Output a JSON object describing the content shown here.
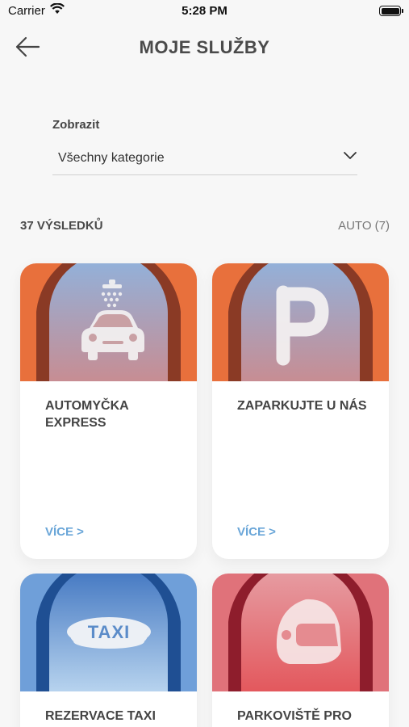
{
  "status_bar": {
    "carrier": "Carrier",
    "time": "5:28 PM"
  },
  "header": {
    "title": "MOJE SLUŽBY",
    "back_icon": "arrow-left-icon"
  },
  "filter": {
    "label": "Zobrazit",
    "selected": "Všechny kategorie"
  },
  "results": {
    "count_label": "37 VÝSLEDKŮ",
    "filter_chip": "AUTO (7)"
  },
  "cards": [
    {
      "title": "AUTOMYČKA EXPRESS",
      "link": "VÍCE >",
      "icon": "car-wash-icon",
      "colors": {
        "arch": "#e8703c",
        "sky_top": "#8fb3de",
        "sky_bottom": "#c78d93"
      }
    },
    {
      "title": "ZAPARKUJTE U NÁS",
      "link": "VÍCE >",
      "icon": "parking-icon",
      "colors": {
        "arch": "#e8703c",
        "sky_top": "#8fb3de",
        "sky_bottom": "#c78d93"
      }
    },
    {
      "title": "REZERVACE TAXI",
      "link": "",
      "icon": "taxi-icon",
      "colors": {
        "arch": "#2f5fa8",
        "sky_top": "#5f8fcf",
        "sky_bottom": "#a8c8e8"
      }
    },
    {
      "title": "PARKOVIŠTĚ PRO",
      "link": "",
      "icon": "motorcycle-helmet-icon",
      "colors": {
        "arch": "#c83b4a",
        "sky_top": "#e49aa0",
        "sky_bottom": "#e35a5e"
      }
    }
  ],
  "colors": {
    "background": "#f7f7f7",
    "link": "#6aa6d8",
    "title": "#4a4a4a"
  }
}
